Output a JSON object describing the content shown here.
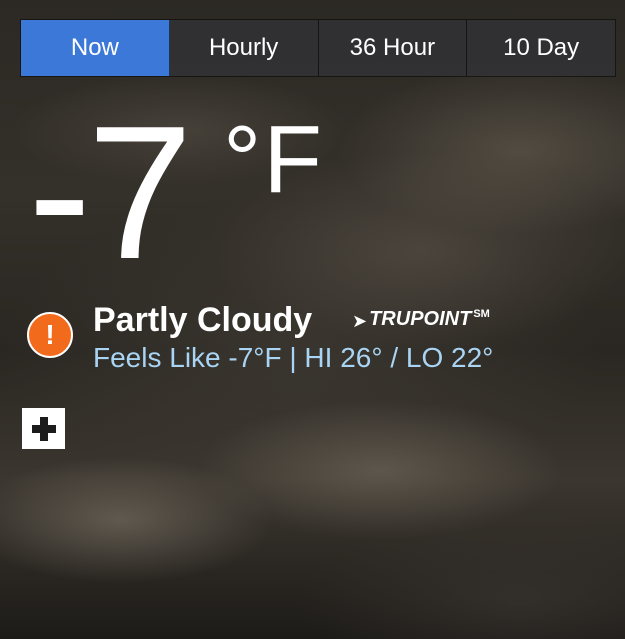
{
  "tabs": {
    "now": "Now",
    "hourly": "Hourly",
    "hour36": "36 Hour",
    "day10": "10 Day",
    "active": "Now"
  },
  "current": {
    "temperature": "-7",
    "unit": "°F",
    "condition": "Partly Cloudy",
    "feels_like_line": "Feels Like -7°F | HI 26° / LO 22°"
  },
  "branding": {
    "trupoint_text": "TRUPOINT",
    "trupoint_mark": "SM"
  },
  "alert": {
    "icon": "alert-exclamation-icon",
    "glyph": "!",
    "color": "#f26a1b"
  },
  "colors": {
    "active_tab": "#3c78d8",
    "feels_like_text": "#a9d4f4"
  },
  "icons": {
    "add": "plus-icon"
  }
}
